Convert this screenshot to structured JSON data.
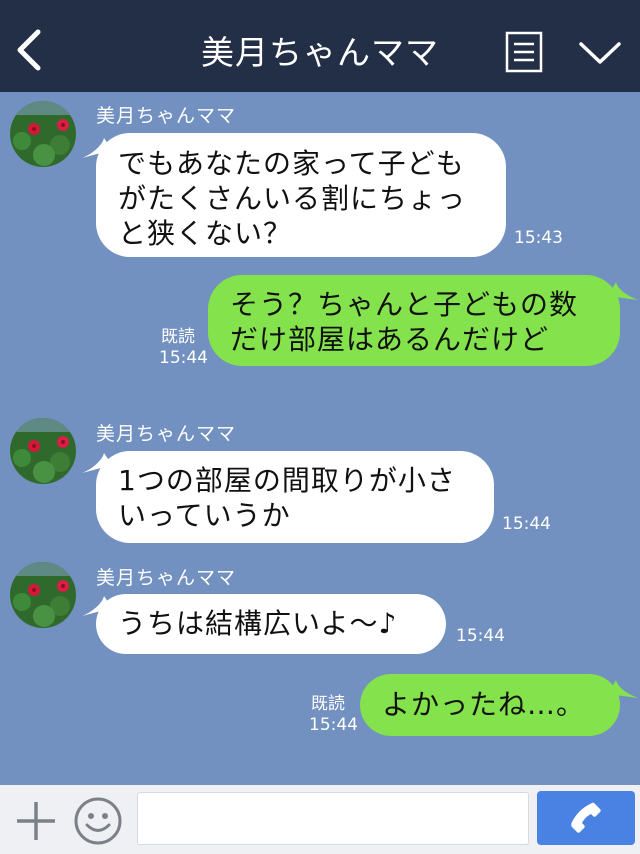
{
  "header": {
    "title": "美月ちゃんママ",
    "back_icon": "chevron-left-icon",
    "menu_icon": "menu-list-icon",
    "collapse_icon": "chevron-down-icon"
  },
  "messages": [
    {
      "direction": "incoming",
      "sender": "美月ちゃんママ",
      "text": "でもあなたの家って子ども\nがたくさんいる割にちょっ\nと狭くない？",
      "time": "15:43"
    },
    {
      "direction": "outgoing",
      "text": "そう？ちゃんと子どもの数\nだけ部屋はあるんだけど",
      "read": "既読",
      "time": "15:44"
    },
    {
      "direction": "incoming",
      "sender": "美月ちゃんママ",
      "text": "1つの部屋の間取りが小さ\nいっていうか",
      "time": "15:44"
    },
    {
      "direction": "incoming",
      "sender": "美月ちゃんママ",
      "text": "うちは結構広いよ〜♪",
      "time": "15:44"
    },
    {
      "direction": "outgoing",
      "text": "よかったね…。",
      "read": "既読",
      "time": "15:44"
    }
  ],
  "input": {
    "plus_icon": "plus-icon",
    "sticker_icon": "smile-icon",
    "send_icon": "phone-icon",
    "placeholder": ""
  },
  "colors": {
    "background": "#7291c0",
    "header": "#232e47",
    "incoming_bubble": "#ffffff",
    "outgoing_bubble": "#84e24c",
    "send_button": "#4a82e4"
  }
}
